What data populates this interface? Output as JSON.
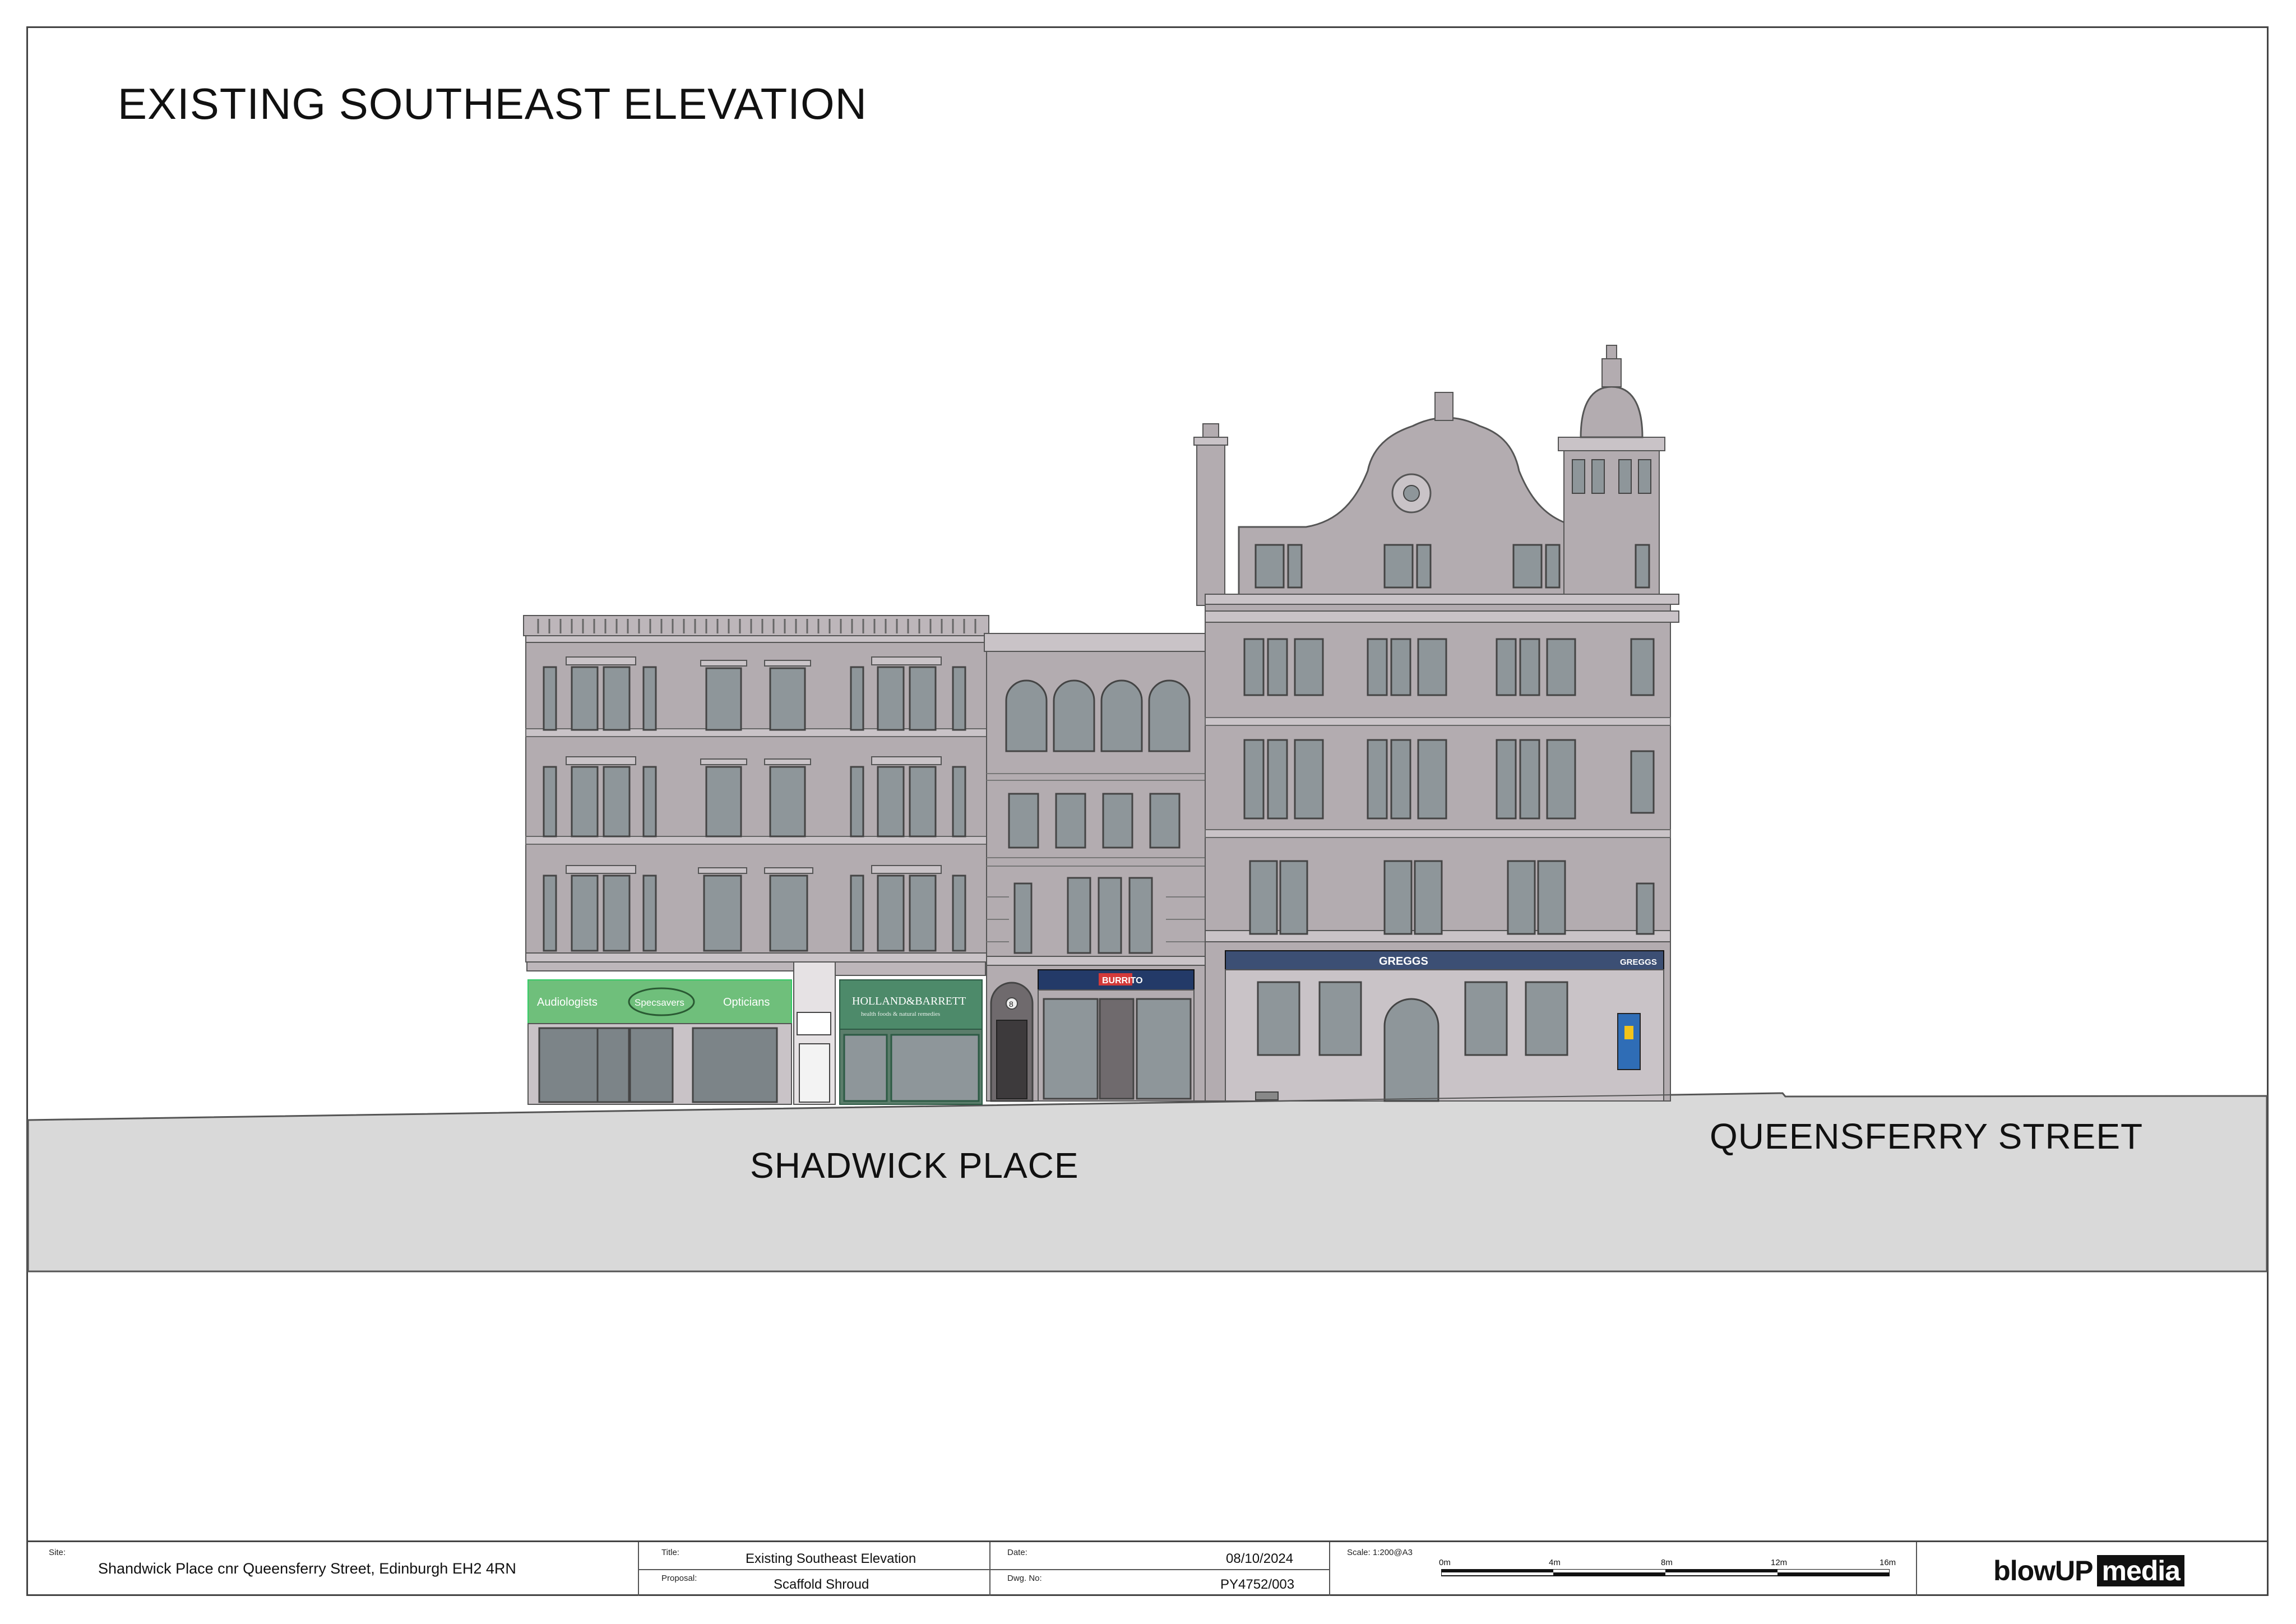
{
  "title": "EXISTING SOUTHEAST ELEVATION",
  "streets": {
    "left": "SHADWICK PLACE",
    "right": "QUEENSFERRY STREET"
  },
  "signage": {
    "specsavers_left": "Audiologists",
    "specsavers_brand": "Specsavers",
    "specsavers_right": "Opticians",
    "holland_barrett": "HOLLAND&BARRETT",
    "holland_barrett_sub": "health foods & natural remedies",
    "burrito": "BURRITO",
    "greggs_1": "GREGGS",
    "greggs_2": "GREGGS",
    "door_number": "8"
  },
  "title_block": {
    "site_caption": "Site:",
    "site": "Shandwick Place cnr Queensferry Street, Edinburgh EH2 4RN",
    "title_caption": "Title:",
    "title": "Existing Southeast Elevation",
    "proposal_caption": "Proposal:",
    "proposal": "Scaffold Shroud",
    "date_caption": "Date:",
    "date": "08/10/2024",
    "dwg_caption": "Dwg. No:",
    "dwg": "PY4752/003",
    "scale_caption": "Scale: 1:200@A3",
    "scale_ticks": [
      "0m",
      "4m",
      "8m",
      "12m",
      "16m"
    ],
    "logo_blow": "blowUP",
    "logo_media": "media"
  },
  "colors": {
    "facade": "#b3acb0",
    "facade_light": "#c9c3c7",
    "window": "#8e969a",
    "street": "#d9d9d9",
    "specsavers": "#6fbf7b",
    "holland": "#4d8a6a",
    "burrito_fascia": "#233a68",
    "greggs_fascia": "#3c4f74"
  }
}
